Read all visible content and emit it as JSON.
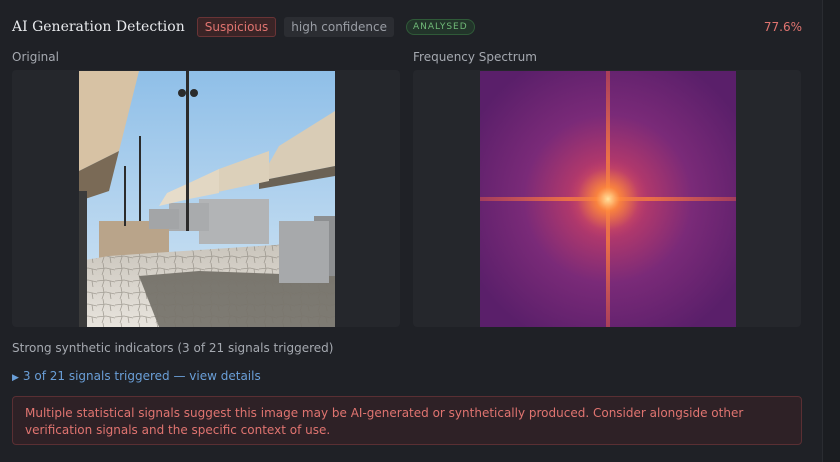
{
  "header": {
    "title": "AI Generation Detection",
    "verdict": "Suspicious",
    "confidence": "high confidence",
    "status": "ANALYSED",
    "score": "77.6%"
  },
  "panels": {
    "original_label": "Original",
    "spectrum_label": "Frequency Spectrum"
  },
  "summary": "Strong synthetic indicators (3 of 21 signals triggered)",
  "details_link": "3 of 21 signals triggered — view details",
  "alert": "Multiple statistical signals suggest this image may be AI-generated or synthetically produced. Consider alongside other verification signals and the specific context of use.",
  "colors": {
    "danger": "#e07470",
    "success": "#6fb877",
    "link": "#6a9fd8",
    "background": "#1f2126"
  },
  "icons": {
    "details_toggle": "triangle-right-icon"
  }
}
